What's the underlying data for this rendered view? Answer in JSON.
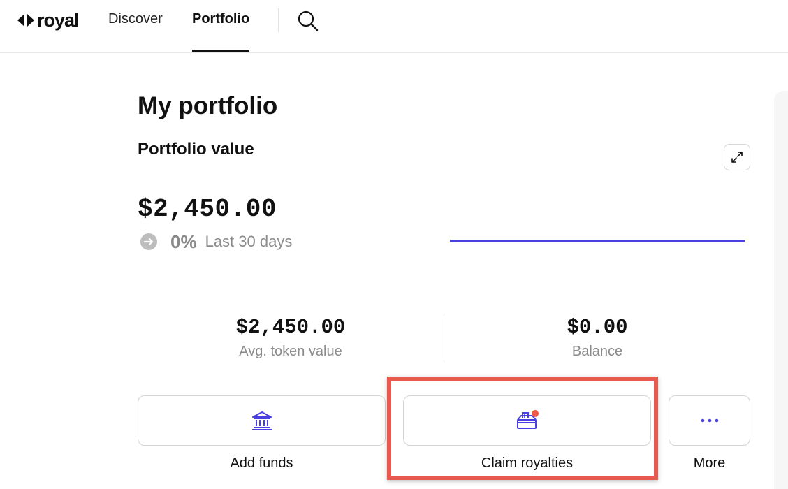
{
  "brand": {
    "name": "royal"
  },
  "nav": {
    "items": [
      {
        "label": "Discover"
      },
      {
        "label": "Portfolio",
        "active": true
      }
    ]
  },
  "main": {
    "title": "My portfolio",
    "portfolio_value": {
      "heading": "Portfolio value",
      "amount": "$2,450.00",
      "change_percent": "0%",
      "change_period": "Last 30 days"
    },
    "stats": [
      {
        "value": "$2,450.00",
        "label": "Avg. token value"
      },
      {
        "value": "$0.00",
        "label": "Balance"
      }
    ],
    "actions": [
      {
        "label": "Add funds",
        "icon": "bank-icon"
      },
      {
        "label": "Claim royalties",
        "icon": "royalties-box-icon",
        "has_notification_dot": true,
        "highlighted": true
      },
      {
        "label": "More",
        "icon": "more-dots-icon"
      }
    ]
  },
  "colors": {
    "accent": "#4a3fe0",
    "notification_dot": "#f05a4a",
    "highlight_border": "#e85a4f",
    "muted_text": "#8a8a8a"
  }
}
